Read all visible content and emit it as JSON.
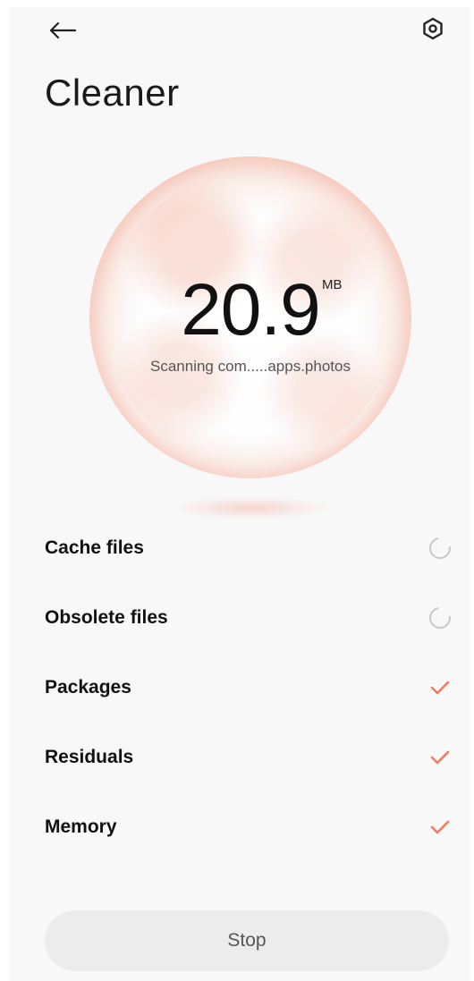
{
  "header": {
    "back_icon": "back-arrow-icon",
    "settings_icon": "settings-hexagon-icon",
    "title": "Cleaner"
  },
  "scan": {
    "value": "20.9",
    "unit": "MB",
    "status": "Scanning com.....apps.photos"
  },
  "items": [
    {
      "label": "Cache files",
      "state": "scanning"
    },
    {
      "label": "Obsolete files",
      "state": "scanning"
    },
    {
      "label": "Packages",
      "state": "done"
    },
    {
      "label": "Residuals",
      "state": "done"
    },
    {
      "label": "Memory",
      "state": "done"
    }
  ],
  "footer": {
    "stop_label": "Stop"
  },
  "colors": {
    "accent": "#f47a60",
    "orb": "#f2a898",
    "spinner": "#c9c9c9"
  }
}
